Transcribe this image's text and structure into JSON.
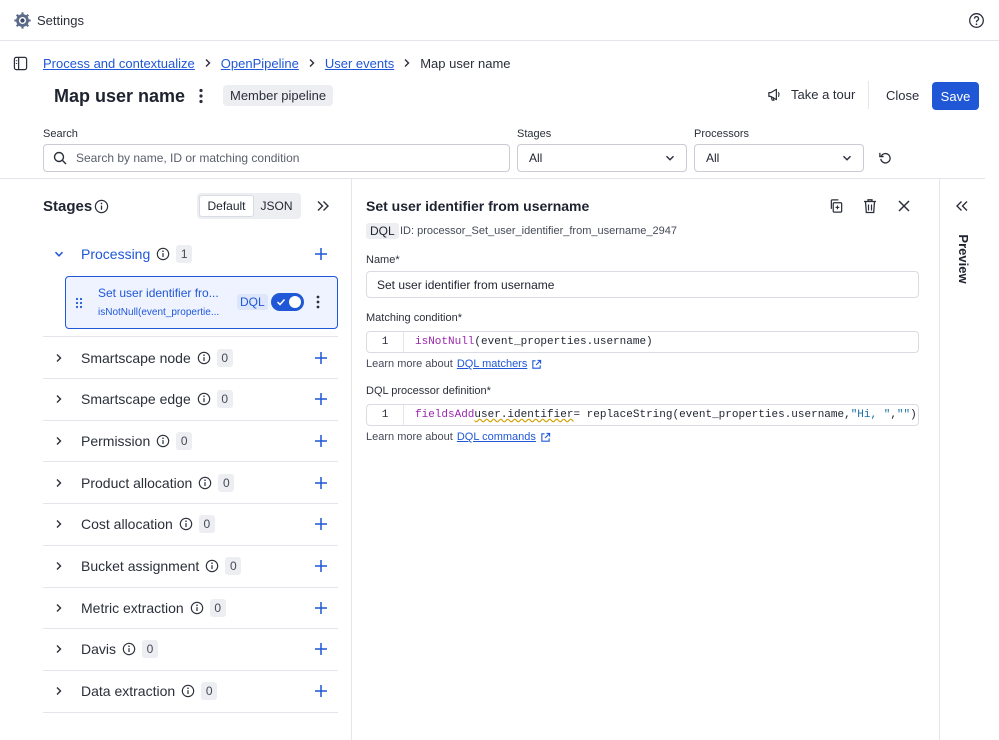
{
  "app": {
    "title": "Settings"
  },
  "breadcrumbs": [
    {
      "label": "Process and contextualize"
    },
    {
      "label": "OpenPipeline"
    },
    {
      "label": "User events"
    },
    {
      "label": "Map user name"
    }
  ],
  "page": {
    "title": "Map user name",
    "badge": "Member pipeline",
    "tour_label": "Take a tour",
    "close_label": "Close",
    "save_label": "Save"
  },
  "filters": {
    "search_label": "Search",
    "search_placeholder": "Search by name, ID or matching condition",
    "stages_label": "Stages",
    "stages_value": "All",
    "processors_label": "Processors",
    "processors_value": "All"
  },
  "stages_panel": {
    "title": "Stages",
    "view_default": "Default",
    "view_json": "JSON",
    "processing": {
      "name": "Processing",
      "count": "1"
    },
    "processor_card": {
      "title": "Set user identifier fro...",
      "subtitle": "isNotNull(event_propertie...",
      "badge": "DQL",
      "enabled": true
    },
    "items": [
      {
        "name": "Smartscape node",
        "count": "0"
      },
      {
        "name": "Smartscape edge",
        "count": "0"
      },
      {
        "name": "Permission",
        "count": "0"
      },
      {
        "name": "Product allocation",
        "count": "0"
      },
      {
        "name": "Cost allocation",
        "count": "0"
      },
      {
        "name": "Bucket assignment",
        "count": "0"
      },
      {
        "name": "Metric extraction",
        "count": "0"
      },
      {
        "name": "Davis",
        "count": "0"
      },
      {
        "name": "Data extraction",
        "count": "0"
      }
    ]
  },
  "detail": {
    "title": "Set user identifier from username",
    "badge": "DQL",
    "id_text": "ID: processor_Set_user_identifier_from_username_2947",
    "name_label": "Name*",
    "name_value": "Set user identifier from username",
    "matching_label": "Matching condition*",
    "matching_line": "1",
    "matching_fn": "isNotNull",
    "matching_rest": "(event_properties.username)",
    "learn_prefix": "Learn more about",
    "matchers_link": "DQL matchers",
    "dql_label": "DQL processor definition*",
    "dql_line": "1",
    "dql_kw": "fieldsAdd",
    "dql_field": "user.identifier",
    "dql_mid": "= replaceString(event_properties.username,",
    "dql_str1": "\"Hi, \"",
    "dql_comma": ",",
    "dql_str2": "\"\"",
    "dql_end": ")",
    "commands_link": "DQL commands"
  },
  "preview": {
    "label": "Preview"
  },
  "colors": {
    "accent": "#1f57d6",
    "purple": "#9c27b0",
    "string": "#1a6fa8",
    "border": "#e4e6ec"
  }
}
